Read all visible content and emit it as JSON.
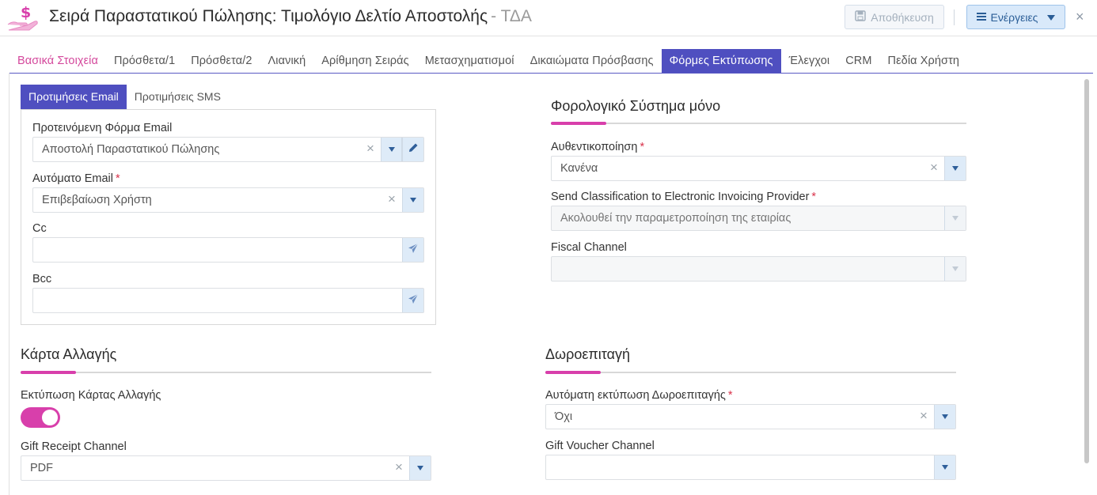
{
  "header": {
    "logo_icon": "dollar-hand-icon",
    "title": "Σειρά Παραστατικού Πώλησης: Τιμολόγιο Δελτίο Αποστολής",
    "subtitle": "- ΤΔΑ",
    "save_label": "Αποθήκευση",
    "actions_label": "Ενέργειες",
    "close_glyph": "×"
  },
  "tabs": [
    {
      "label": "Βασικά Στοιχεία"
    },
    {
      "label": "Πρόσθετα/1"
    },
    {
      "label": "Πρόσθετα/2"
    },
    {
      "label": "Λιανική"
    },
    {
      "label": "Αρίθμηση Σειράς"
    },
    {
      "label": "Μετασχηματισμοί"
    },
    {
      "label": "Δικαιώματα Πρόσβασης"
    },
    {
      "label": "Φόρμες Εκτύπωσης"
    },
    {
      "label": "Έλεγχοι"
    },
    {
      "label": "CRM"
    },
    {
      "label": "Πεδία Χρήστη"
    }
  ],
  "active_tab": "Φόρμες Εκτύπωσης",
  "email_section": {
    "subtabs": [
      {
        "label": "Προτιμήσεις Email"
      },
      {
        "label": "Προτιμήσεις SMS"
      }
    ],
    "default_form": {
      "label": "Προτεινόμενη Φόρμα Email",
      "value": "Αποστολή Παραστατικού Πώλησης"
    },
    "auto_email": {
      "label": "Αυτόματο Email",
      "required": "*",
      "value": "Επιβεβαίωση Χρήστη"
    },
    "cc": {
      "label": "Cc",
      "value": ""
    },
    "bcc": {
      "label": "Bcc",
      "value": ""
    }
  },
  "fiscal_section": {
    "title": "Φορολογικό Σύστημα μόνο",
    "auth": {
      "label": "Αυθεντικοποίηση",
      "required": "*",
      "value": "Κανένα"
    },
    "classification": {
      "label": "Send Classification to Electronic Invoicing Provider",
      "required": "*",
      "value": "Ακολουθεί την παραμετροποίηση της εταιρίας"
    },
    "fiscal_channel": {
      "label": "Fiscal Channel",
      "value": ""
    }
  },
  "change_card": {
    "title": "Κάρτα Αλλαγής",
    "print_label": "Εκτύπωση Κάρτας Αλλαγής",
    "print_enabled": true,
    "gift_receipt_channel": {
      "label": "Gift Receipt Channel",
      "value": "PDF"
    }
  },
  "gift_voucher": {
    "title": "Δωροεπιταγή",
    "auto_print": {
      "label": "Αυτόματη εκτύπωση Δωροεπιταγής",
      "required": "*",
      "value": "Όχι"
    },
    "channel": {
      "label": "Gift Voucher Channel",
      "value": ""
    }
  },
  "colors": {
    "accent": "#d83fab",
    "tab_active": "#4f4fc0",
    "button_blue": "#deebf8"
  }
}
